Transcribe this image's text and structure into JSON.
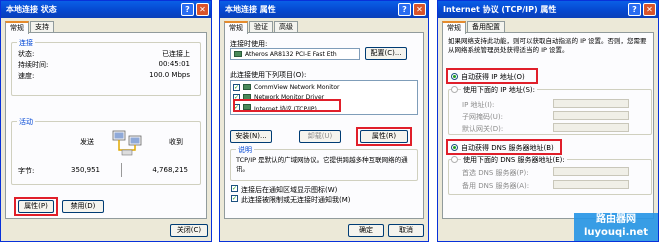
{
  "status": {
    "title": "本地连接 状态",
    "tabs": [
      "常规",
      "支持"
    ],
    "conn_group": "连接",
    "rows": [
      {
        "label": "状态:",
        "value": "已连接上"
      },
      {
        "label": "持续时间:",
        "value": "00:45:01"
      },
      {
        "label": "速度:",
        "value": "100.0 Mbps"
      }
    ],
    "activity_group": "活动",
    "sent": "发送",
    "received": "收到",
    "bytes_label": "字节:",
    "bytes_sent": "350,951",
    "bytes_received": "4,768,215",
    "props_btn": "属性(P)",
    "disable_btn": "禁用(D)",
    "close_btn": "关闭(C)"
  },
  "props": {
    "title": "本地连接 属性",
    "tabs": [
      "常规",
      "验证",
      "高级"
    ],
    "connect_using": "连接时使用:",
    "adapter": "Atheros AR8132 PCI-E Fast Eth",
    "config_btn": "配置(C)...",
    "items_label": "此连接使用下列项目(O):",
    "items": [
      "CommView Network Monitor",
      "Network Monitor Driver",
      "Internet 协议 (TCP/IP)"
    ],
    "install_btn": "安装(N)...",
    "uninstall_btn": "卸载(U)",
    "props_btn": "属性(R)",
    "desc_group": "说明",
    "desc_text": "TCP/IP 是默认的广域网协议。它提供跨越多种互联网络的通讯。",
    "check1": "连接后在通知区域显示图标(W)",
    "check2": "此连接被限制或无连接时通知我(M)",
    "ok_btn": "确定",
    "cancel_btn": "取消"
  },
  "tcpip": {
    "title": "Internet 协议 (TCP/IP) 属性",
    "tabs": [
      "常规",
      "备用配置"
    ],
    "intro": "如果网络支持此功能，则可以获取自动指派的 IP 设置。否则，您需要从网络系统管理员处获得适当的 IP 设置。",
    "auto_ip": "自动获得 IP 地址(O)",
    "manual_ip": "使用下面的 IP 地址(S):",
    "ip_fields": [
      "IP 地址(I):",
      "子网掩码(U):",
      "默认网关(D):"
    ],
    "auto_dns": "自动获得 DNS 服务器地址(B)",
    "manual_dns": "使用下面的 DNS 服务器地址(E):",
    "dns_fields": [
      "首选 DNS 服务器(P):",
      "备用 DNS 服务器(A):"
    ]
  },
  "watermark": {
    "line1": "路由器网",
    "line2": "luyouqi.net"
  },
  "colors": {
    "title_bar": "#0548d0",
    "highlight": "#e01f2a",
    "group_label": "#0046d5"
  }
}
